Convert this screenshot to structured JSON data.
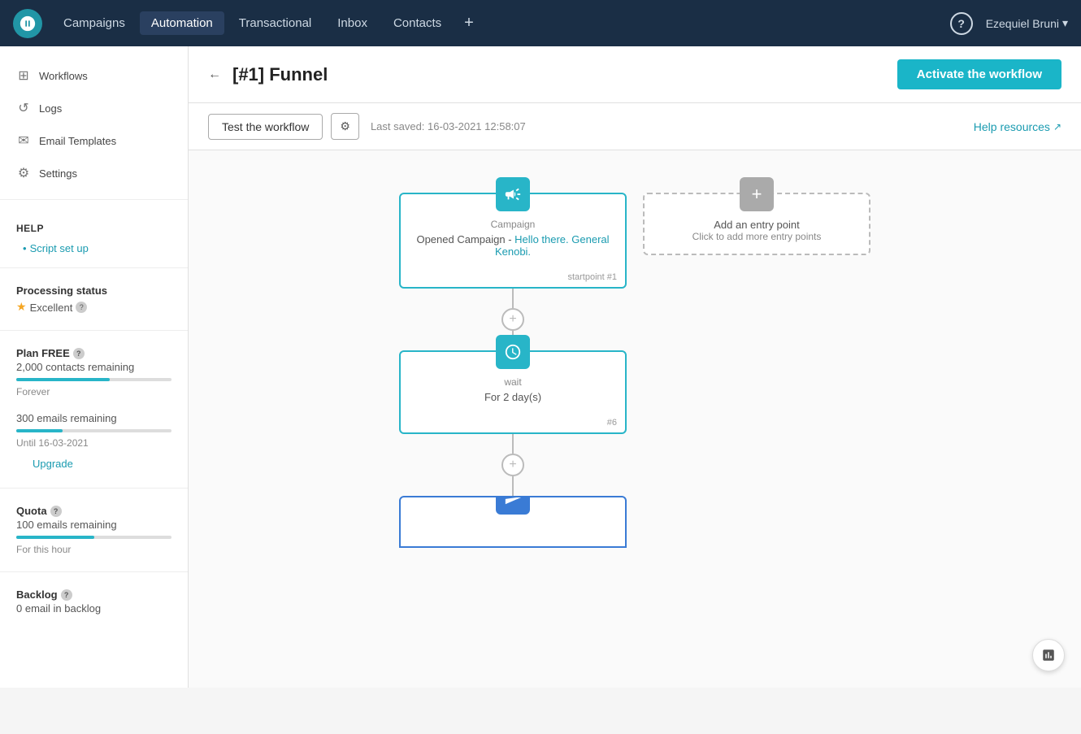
{
  "topnav": {
    "logo_alt": "Brevo logo",
    "items": [
      {
        "label": "Campaigns",
        "active": false
      },
      {
        "label": "Automation",
        "active": true
      },
      {
        "label": "Transactional",
        "active": false
      },
      {
        "label": "Inbox",
        "active": false
      },
      {
        "label": "Contacts",
        "active": false
      }
    ],
    "plus_label": "+",
    "help_label": "?",
    "user_name": "Ezequiel Bruni"
  },
  "sidebar": {
    "items": [
      {
        "label": "Workflows",
        "icon": "⊞"
      },
      {
        "label": "Logs",
        "icon": "↺"
      },
      {
        "label": "Email Templates",
        "icon": "✉"
      },
      {
        "label": "Settings",
        "icon": "⚙"
      }
    ],
    "help_section": "Help",
    "script_setup_link": "Script set up",
    "processing_status_label": "Processing status",
    "processing_status_value": "Excellent",
    "plan_label": "Plan FREE",
    "contacts_remaining": "2,000 contacts remaining",
    "contacts_period": "Forever",
    "emails_remaining": "300 emails remaining",
    "emails_until": "Until 16-03-2021",
    "upgrade_label": "Upgrade",
    "quota_label": "Quota",
    "quota_value": "100 emails remaining",
    "quota_period": "For this hour",
    "backlog_label": "Backlog",
    "backlog_value": "0 email in backlog"
  },
  "main": {
    "back_label": "←",
    "page_title": "[#1] Funnel",
    "activate_btn": "Activate the workflow",
    "test_btn": "Test the workflow",
    "settings_icon": "⚙",
    "last_saved": "Last saved: 16-03-2021 12:58:07",
    "help_resources": "Help resources",
    "workflow": {
      "node1": {
        "icon": "📢",
        "type": "Campaign",
        "content_prefix": "Opened Campaign -",
        "content_link": "Hello there. General Kenobi.",
        "footer": "startpoint #1"
      },
      "node_add": {
        "icon": "+",
        "title": "Add an entry point",
        "subtitle": "Click to add more entry points"
      },
      "node2": {
        "icon": "⚙",
        "type": "wait",
        "content": "For 2 day(s)",
        "footer": "#6"
      },
      "node3": {
        "icon": "✉",
        "type": ""
      }
    }
  }
}
